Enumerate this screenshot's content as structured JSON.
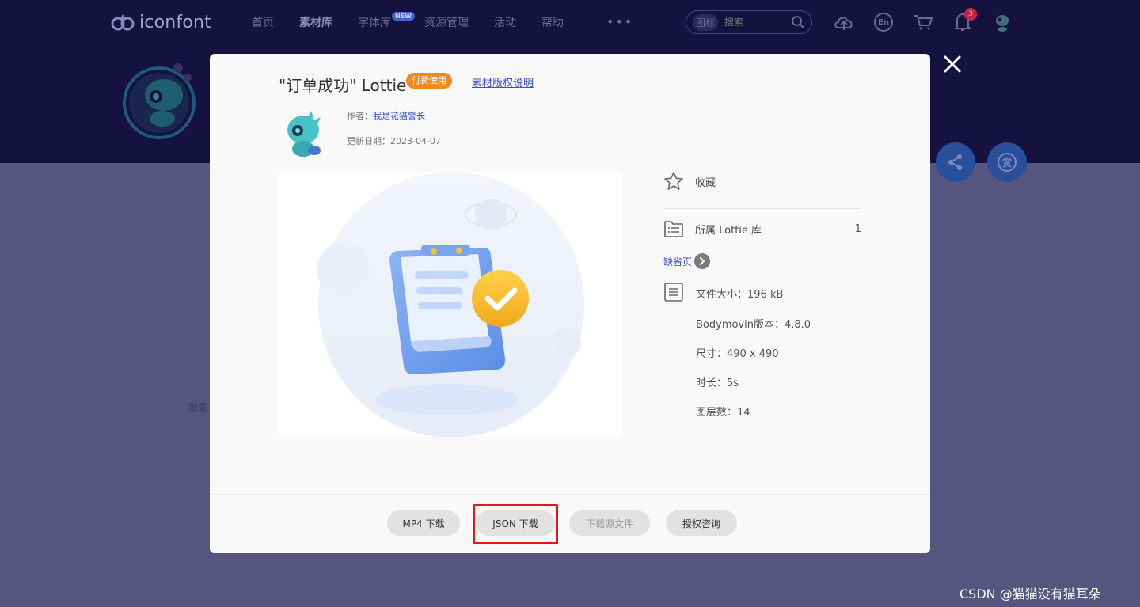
{
  "header": {
    "logo_text": "iconfont",
    "nav": [
      "首页",
      "素材库",
      "字体库",
      "资源管理",
      "活动",
      "帮助"
    ],
    "new_badge": "NEW",
    "more": "•••",
    "search_type": "图标",
    "search_placeholder": "搜索",
    "en_label": "En",
    "notification_count": "3"
  },
  "background": {
    "loading_text": "加载"
  },
  "modal": {
    "title": "\"订单成功\" Lottie",
    "paid_badge": "付费使用",
    "copyright_link": "素材版权说明",
    "author_label": "作者：",
    "author_name": "我是花猫警长",
    "date_label": "更新日期：",
    "date_value": "2023-04-07",
    "favorite_label": "收藏",
    "library_label": "所属 Lottie 库",
    "library_count": "1",
    "default_page": "缺省页",
    "details": [
      "文件大小：196 kB",
      "Bodymovin版本：4.8.0",
      "尺寸：490 x 490",
      "时长：5s",
      "图层数：14"
    ],
    "buttons": {
      "mp4": "MP4 下载",
      "json": "JSON 下载",
      "source": "下载源文件",
      "license": "授权咨询"
    }
  },
  "colors": {
    "accent_link": "#3a4fc9",
    "paid_badge": "#f08a1f",
    "highlight_box": "#e01818",
    "check_badge": "#f5b731"
  },
  "watermark": "CSDN @猫猫没有猫耳朵"
}
